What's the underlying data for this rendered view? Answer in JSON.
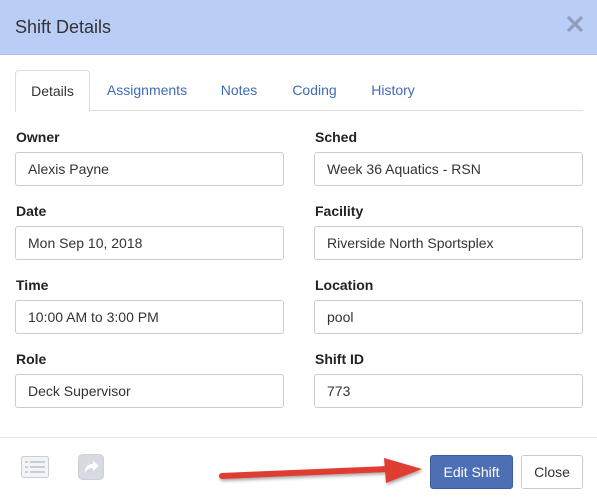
{
  "dialog": {
    "title": "Shift Details",
    "close_icon": "close-icon"
  },
  "tabs": [
    {
      "label": "Details",
      "active": true
    },
    {
      "label": "Assignments",
      "active": false
    },
    {
      "label": "Notes",
      "active": false
    },
    {
      "label": "Coding",
      "active": false
    },
    {
      "label": "History",
      "active": false
    }
  ],
  "fields": {
    "owner": {
      "label": "Owner",
      "value": "Alexis Payne"
    },
    "sched": {
      "label": "Sched",
      "value": "Week 36 Aquatics - RSN"
    },
    "date": {
      "label": "Date",
      "value": "Mon Sep 10, 2018"
    },
    "facility": {
      "label": "Facility",
      "value": "Riverside North Sportsplex"
    },
    "time": {
      "label": "Time",
      "value": "10:00 AM to 3:00 PM"
    },
    "location": {
      "label": "Location",
      "value": "pool"
    },
    "role": {
      "label": "Role",
      "value": "Deck Supervisor"
    },
    "shift_id": {
      "label": "Shift ID",
      "value": "773"
    }
  },
  "footer": {
    "icons": [
      "list-icon",
      "share-icon"
    ],
    "edit_label": "Edit Shift",
    "close_label": "Close"
  },
  "colors": {
    "header_bg": "#b9cdf6",
    "primary_button": "#4e6fb3",
    "link": "#3e6bb5",
    "annotation_arrow": "#e03c31"
  }
}
